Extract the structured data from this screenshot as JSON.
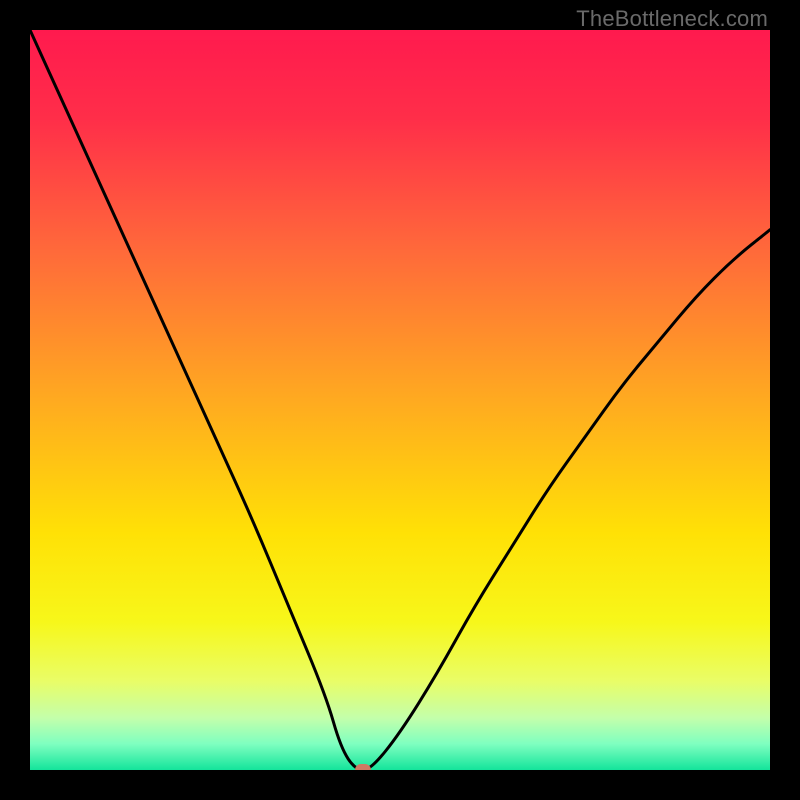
{
  "watermark": "TheBottleneck.com",
  "marker_color": "#cf7a63",
  "chart_data": {
    "type": "line",
    "title": "",
    "xlabel": "",
    "ylabel": "",
    "xlim": [
      0,
      100
    ],
    "ylim": [
      0,
      100
    ],
    "series": [
      {
        "name": "bottleneck-curve",
        "x": [
          0,
          5,
          10,
          15,
          20,
          25,
          30,
          35,
          40,
          42,
          44,
          46,
          50,
          55,
          60,
          65,
          70,
          75,
          80,
          85,
          90,
          95,
          100
        ],
        "values": [
          100,
          89,
          78,
          67,
          56,
          45,
          34,
          22,
          10,
          3,
          0,
          0,
          5,
          13,
          22,
          30,
          38,
          45,
          52,
          58,
          64,
          69,
          73
        ]
      }
    ],
    "annotations": [
      {
        "type": "marker",
        "x": 45,
        "y": 0,
        "color": "#cf7a63"
      }
    ],
    "gradient_stops": [
      {
        "pos": 0.0,
        "color": "#ff1a4e"
      },
      {
        "pos": 0.12,
        "color": "#ff2e49"
      },
      {
        "pos": 0.3,
        "color": "#ff6a3a"
      },
      {
        "pos": 0.5,
        "color": "#ffaa20"
      },
      {
        "pos": 0.68,
        "color": "#ffe106"
      },
      {
        "pos": 0.8,
        "color": "#f7f71a"
      },
      {
        "pos": 0.88,
        "color": "#e9fd67"
      },
      {
        "pos": 0.93,
        "color": "#c3ffab"
      },
      {
        "pos": 0.965,
        "color": "#7effc0"
      },
      {
        "pos": 1.0,
        "color": "#14e49b"
      }
    ]
  }
}
